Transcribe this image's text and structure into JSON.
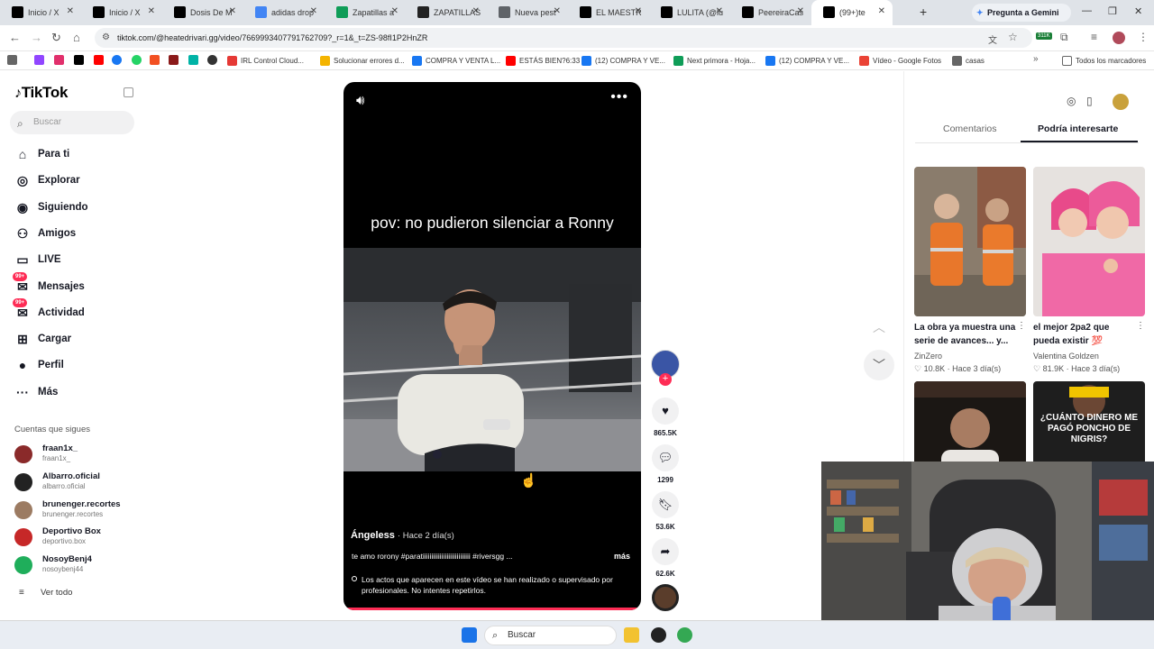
{
  "browser": {
    "tabs": [
      {
        "title": "Inicio / X",
        "icon": "x-logo-icon",
        "color": "#000000"
      },
      {
        "title": "Inicio / X",
        "icon": "x-logo-icon",
        "color": "#000000"
      },
      {
        "title": "Dosis De M",
        "icon": "x-logo-icon",
        "color": "#000000"
      },
      {
        "title": "adidas drop",
        "icon": "google-icon",
        "color": "#4285f4"
      },
      {
        "title": "Zapatillas a",
        "icon": "sheets-icon",
        "color": "#0f9d58"
      },
      {
        "title": "ZAPATILLAS",
        "icon": "github-icon",
        "color": "#222222"
      },
      {
        "title": "Nueva pest",
        "icon": "chrome-icon",
        "color": "#5f6368"
      },
      {
        "title": "EL MAESTR",
        "icon": "tiktok-icon",
        "color": "#000000"
      },
      {
        "title": "LULITA (@lu",
        "icon": "tiktok-icon",
        "color": "#000000"
      },
      {
        "title": "PeereiraCas",
        "icon": "x-logo-icon",
        "color": "#000000"
      },
      {
        "title": "(99+)te",
        "icon": "tiktok-icon",
        "color": "#000000",
        "active": true
      }
    ],
    "gemini_label": "Pregunta a Gemini",
    "url": "tiktok.com/@heatedrivari.gg/video/7669993407791762709?_r=1&_t=ZS-98fI1P2HnZR",
    "extension_badge": "311K",
    "bookmarks": [
      {
        "label": "IRL Control Cloud...",
        "color": "#e53935"
      },
      {
        "label": "Solucionar errores d...",
        "color": "#f4b400"
      },
      {
        "label": "COMPRA Y VENTA L...",
        "color": "#1877f2"
      },
      {
        "label": "ESTÁS BIEN?6:33",
        "color": "#ff0000"
      },
      {
        "label": "(12) COMPRA Y VE...",
        "color": "#1877f2"
      },
      {
        "label": "Next primora - Hoja...",
        "color": "#0f9d58"
      },
      {
        "label": "(12) COMPRA Y VE...",
        "color": "#1877f2"
      },
      {
        "label": "Vídeo - Google Fotos",
        "color": "#ea4335"
      },
      {
        "label": "casas",
        "color": "#666666"
      }
    ],
    "all_bookmarks": "Todos los marcadores"
  },
  "sidebar": {
    "logo": "TikTok",
    "search_placeholder": "Buscar",
    "items": [
      {
        "label": "Para ti",
        "icon": "home-icon"
      },
      {
        "label": "Explorar",
        "icon": "compass-icon"
      },
      {
        "label": "Siguiendo",
        "icon": "following-icon"
      },
      {
        "label": "Amigos",
        "icon": "friends-icon"
      },
      {
        "label": "LIVE",
        "icon": "live-icon"
      },
      {
        "label": "Mensajes",
        "icon": "messages-icon",
        "badge": "99+"
      },
      {
        "label": "Actividad",
        "icon": "activity-icon",
        "badge": "99+"
      },
      {
        "label": "Cargar",
        "icon": "upload-icon"
      },
      {
        "label": "Perfil",
        "icon": "profile-icon"
      },
      {
        "label": "Más",
        "icon": "more-icon"
      }
    ],
    "following_title": "Cuentas que sigues",
    "following": [
      {
        "name": "fraan1x_",
        "handle": "fraan1x_",
        "color": "#8a2a2a"
      },
      {
        "name": "Albarro.oficial",
        "handle": "albarro.oficial",
        "color": "#222222"
      },
      {
        "name": "brunenger.recortes",
        "handle": "brunenger.recortes",
        "color": "#9c7b62"
      },
      {
        "name": "Deportivo Box",
        "handle": "deportivo.box",
        "color": "#c62828"
      },
      {
        "name": "NosoyBenj4",
        "handle": "nosoybenj44",
        "color": "#1fae5b"
      }
    ],
    "see_all": "Ver todo"
  },
  "video": {
    "caption": "pov: no pudieron silenciar a Ronny",
    "author": "Ángeless",
    "time": "· Hace 2 día(s)",
    "description": "te amo rorony #paratiiiiiiiiiiiiiiiiiiiiiiiiiiii #riversgg ...",
    "more_label": "más",
    "warning": "Los actos que aparecen en este vídeo se han realizado o supervisado por profesionales. No intentes repetirlos."
  },
  "actions": {
    "likes": "865.5K",
    "comments": "1299",
    "saves": "53.6K",
    "shares": "62.6K"
  },
  "right_panel": {
    "tab_comments": "Comentarios",
    "tab_recommend": "Podría interesarte",
    "cards": [
      {
        "title": "La obra ya muestra una serie de avances... y...",
        "author": "ZinZero",
        "likes": "10.8K",
        "time": "Hace 3 día(s)"
      },
      {
        "title": "el mejor 2pa2 que pueda existir 💯",
        "author": "Valentina Goldzen",
        "likes": "81.9K",
        "time": "Hace 3 día(s)"
      },
      {
        "title": "",
        "author": "",
        "likes": "",
        "time": ""
      },
      {
        "title": "¿CUÁNTO DINERO ME PAGÓ PONCHO DE NIGRIS?",
        "author": "",
        "likes": "",
        "time": ""
      }
    ]
  },
  "taskbar": {
    "search_label": "Buscar"
  }
}
